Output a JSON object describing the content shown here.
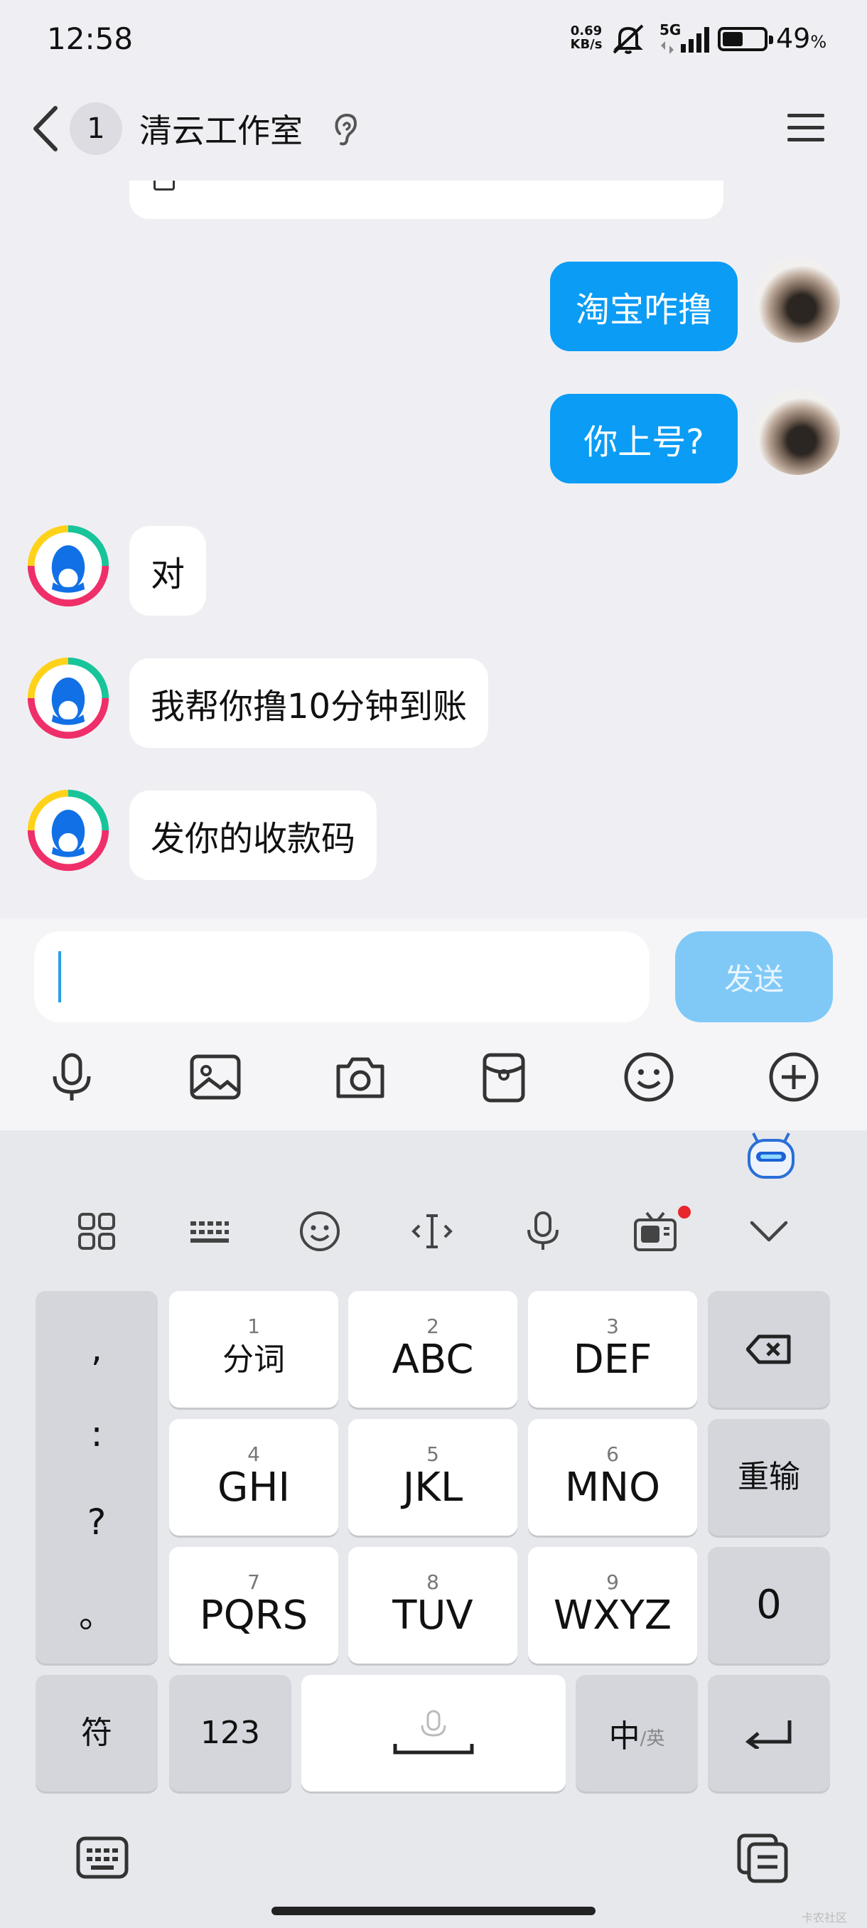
{
  "status_bar": {
    "time": "12:58",
    "net_speed_value": "0.69",
    "net_speed_unit": "KB/s",
    "signal": "5G",
    "battery": "49",
    "battery_unit": "%"
  },
  "header": {
    "unread_count": "1",
    "title": "清云工作室"
  },
  "messages": [
    {
      "side": "out",
      "text": "淘宝咋撸"
    },
    {
      "side": "out",
      "text": "你上号?"
    },
    {
      "side": "in",
      "text": "对"
    },
    {
      "side": "in",
      "text": "我帮你撸10分钟到账"
    },
    {
      "side": "in",
      "text": "发你的收款码"
    }
  ],
  "composer": {
    "input_value": "",
    "send_label": "发送"
  },
  "toolbar_icons": [
    "mic-icon",
    "image-icon",
    "camera-icon",
    "red-packet-icon",
    "emoji-icon",
    "plus-icon"
  ],
  "keyboard": {
    "punct_keys": [
      ",",
      ":",
      "?",
      "。"
    ],
    "keys": [
      {
        "num": "1",
        "label": "分词"
      },
      {
        "num": "2",
        "label": "ABC"
      },
      {
        "num": "3",
        "label": "DEF"
      },
      {
        "num": "4",
        "label": "GHI"
      },
      {
        "num": "5",
        "label": "JKL"
      },
      {
        "num": "6",
        "label": "MNO"
      },
      {
        "num": "7",
        "label": "PQRS"
      },
      {
        "num": "8",
        "label": "TUV"
      },
      {
        "num": "9",
        "label": "WXYZ"
      }
    ],
    "reinput_label": "重输",
    "zero_label": "0",
    "symbol_label": "符",
    "numeric_label": "123",
    "lang_label_main": "中",
    "lang_label_sub": "/英"
  },
  "watermark": "卡农社区",
  "colors": {
    "accent": "#0b9cf5",
    "send_disabled": "#80c9f7",
    "notification_dot": "#e8262c"
  }
}
